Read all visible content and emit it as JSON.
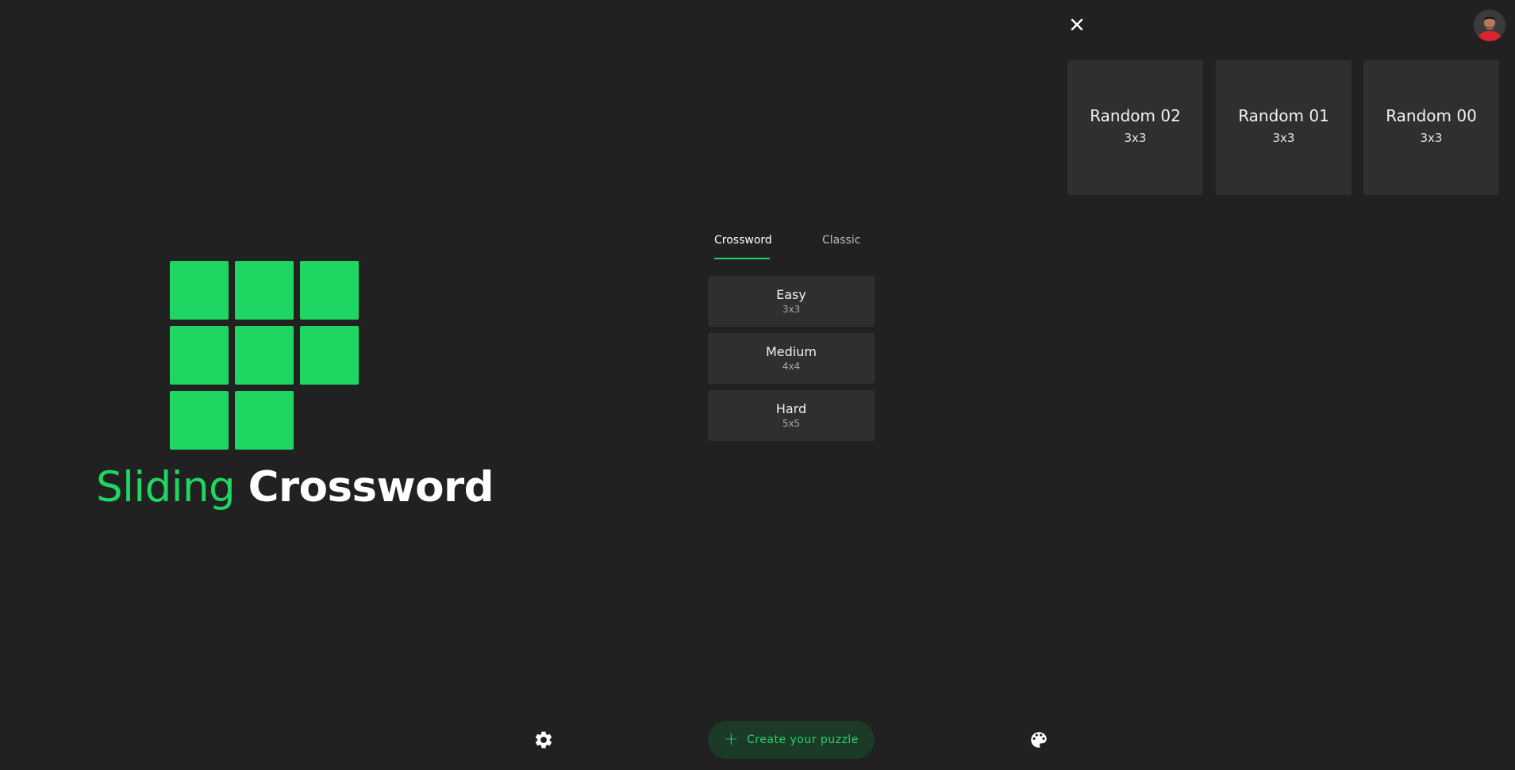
{
  "logo": {
    "title_word_1": "Sliding",
    "title_word_2": "Crossword",
    "tile_color": "#1fd662"
  },
  "tabs": [
    {
      "label": "Crossword",
      "active": true
    },
    {
      "label": "Classic",
      "active": false
    }
  ],
  "difficulties": [
    {
      "name": "Easy",
      "size": "3x3"
    },
    {
      "name": "Medium",
      "size": "4x4"
    },
    {
      "name": "Hard",
      "size": "5x5"
    }
  ],
  "random_puzzles": [
    {
      "name": "Random 02",
      "size": "3x3"
    },
    {
      "name": "Random 01",
      "size": "3x3"
    },
    {
      "name": "Random 00",
      "size": "3x3"
    }
  ],
  "bottom_bar": {
    "create_label": "Create your puzzle",
    "create_icon": "plus-icon",
    "settings_icon": "gear-icon",
    "theme_icon": "palette-icon"
  },
  "header": {
    "close_icon": "close-icon",
    "avatar": "user-avatar"
  },
  "colors": {
    "background": "#212121",
    "accent": "#1fd662",
    "surface": "#2f2f2f"
  }
}
